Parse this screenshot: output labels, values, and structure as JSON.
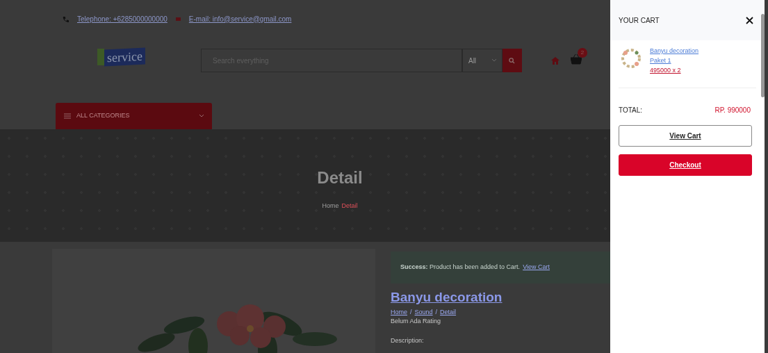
{
  "top_bar": {
    "phone": "Telephone: +6285000000000",
    "email": "E-mail: info@service@gmail.com"
  },
  "header": {
    "logo": "service",
    "search": {
      "placeholder": "Search everything",
      "category": "All"
    },
    "cart_count": "2",
    "categories_button": "ALL CATEGORIES"
  },
  "banner": {
    "title": "Detail",
    "breadcrumb": [
      {
        "label": "Home",
        "selected": false
      },
      {
        "label": "Detail",
        "selected": true
      }
    ]
  },
  "product": {
    "alert": "**Success:** Product has been added to Cart.",
    "alert_link": "View Cart",
    "title": "Banyu decoration",
    "breadcrumb": [
      "Home",
      "Sound",
      "Detail"
    ],
    "breadcrumb_separator": "/",
    "rating": "Belum Ada Rating",
    "description_label": "Description:"
  },
  "cart": {
    "title": "YOUR CART",
    "items": [
      {
        "name": "Banyu decoration",
        "variant": "Paket 1",
        "price": "495000 x 2"
      }
    ],
    "total_label": "TOTAL:",
    "total": "RP. 990000",
    "buttons": [
      {
        "kind": "outline",
        "label": "View Cart"
      },
      {
        "kind": "primary",
        "label": "Checkout"
      }
    ]
  }
}
